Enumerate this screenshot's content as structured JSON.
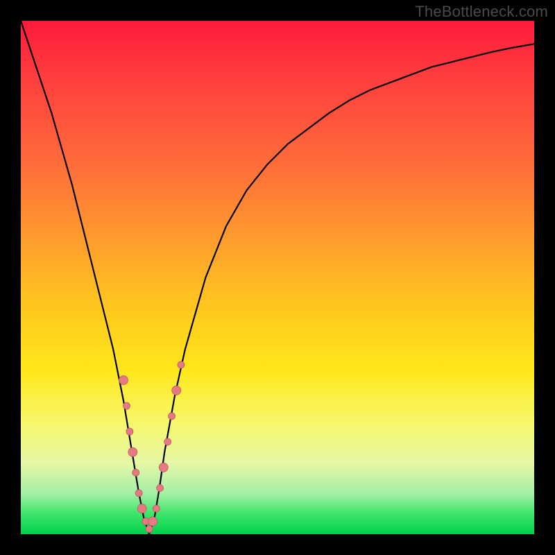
{
  "watermark": "TheBottleneck.com",
  "colors": {
    "frame_bg": "#000000",
    "gradient_top": "#ff1a3a",
    "gradient_bottom": "#00d14a",
    "curve_stroke": "#000000",
    "marker_fill": "#e67a82",
    "marker_stroke": "#c05a62"
  },
  "chart_data": {
    "type": "line",
    "title": "",
    "xlabel": "",
    "ylabel": "",
    "xlim": [
      0,
      100
    ],
    "ylim": [
      0,
      100
    ],
    "x": [
      0,
      2,
      4,
      6,
      8,
      10,
      12,
      14,
      16,
      18,
      20,
      21,
      22,
      23,
      24,
      25,
      26,
      27,
      28,
      30,
      32,
      34,
      36,
      38,
      40,
      44,
      48,
      52,
      56,
      60,
      64,
      68,
      72,
      76,
      80,
      84,
      88,
      92,
      96,
      100
    ],
    "y": [
      100,
      94,
      88,
      82,
      75,
      68,
      60,
      52,
      44,
      36,
      26,
      20,
      14,
      8,
      3,
      0,
      3,
      9,
      16,
      27,
      36,
      43,
      50,
      55,
      60,
      67,
      72,
      76,
      79,
      82,
      84.5,
      86.5,
      88,
      89.5,
      91,
      92,
      93,
      94,
      94.8,
      95.5
    ],
    "series": [
      {
        "name": "bottleneck-curve",
        "note": "V-shaped bottleneck curve; minimum near x≈25 where y≈0 (green zone). Left arm rises steeply to 100 at x=0, right arm rises asymptotically toward ~96."
      }
    ],
    "markers": {
      "note": "pink sample markers clustered on both arms near the bottom of the V (y roughly 5–35)",
      "points": [
        {
          "x": 20.0,
          "y": 30
        },
        {
          "x": 20.6,
          "y": 25
        },
        {
          "x": 21.2,
          "y": 20
        },
        {
          "x": 21.8,
          "y": 16
        },
        {
          "x": 22.4,
          "y": 12
        },
        {
          "x": 23.0,
          "y": 8
        },
        {
          "x": 23.6,
          "y": 5
        },
        {
          "x": 24.3,
          "y": 2.5
        },
        {
          "x": 25.0,
          "y": 1
        },
        {
          "x": 25.7,
          "y": 2.5
        },
        {
          "x": 26.4,
          "y": 5
        },
        {
          "x": 27.1,
          "y": 9
        },
        {
          "x": 27.8,
          "y": 13
        },
        {
          "x": 28.6,
          "y": 18
        },
        {
          "x": 29.4,
          "y": 23
        },
        {
          "x": 30.3,
          "y": 28
        },
        {
          "x": 31.2,
          "y": 33
        }
      ]
    }
  }
}
